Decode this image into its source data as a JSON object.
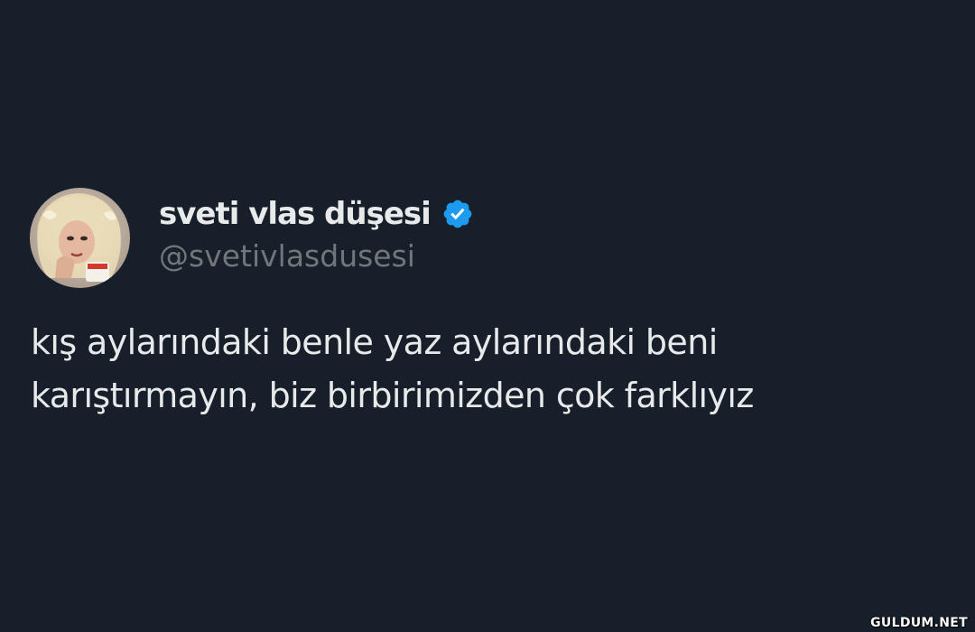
{
  "author": {
    "display_name": "sveti vlas düşesi",
    "handle": "@svetivlasdusesi",
    "verified": true,
    "verified_icon": "verified-badge-icon",
    "verified_color": "#1d9bf0"
  },
  "tweet": {
    "text_lines": [
      "kış aylarındaki benle yaz aylarındaki beni",
      "karıştırmayın, biz birbirimizden çok farklıyız"
    ]
  },
  "watermark": "GULDUM.NET",
  "colors": {
    "background": "#17202a",
    "primary_text": "#e7e9ea",
    "secondary_text": "#71767b"
  }
}
